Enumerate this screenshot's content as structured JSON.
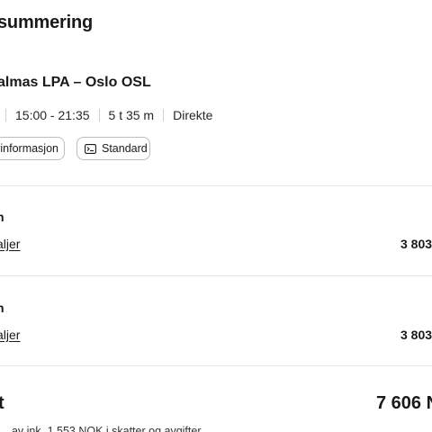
{
  "summary": {
    "title": "summering"
  },
  "flight": {
    "route": "almas LPA – Oslo OSL",
    "time": "15:00 - 21:35",
    "duration": "5 t 35 m",
    "stops": "Direkte",
    "info_chip_label": "yinformasjon",
    "fare_chip_label": "Standard"
  },
  "passengers": [
    {
      "label": "n",
      "details_label": "aljer",
      "price": "3 803"
    },
    {
      "label": "n",
      "details_label": "aljer",
      "price": "3 803"
    }
  ],
  "total": {
    "label": "t",
    "price": "7 606 N",
    "tax_note": "… av ink. 1 553 NOK i skatter og avgifter"
  },
  "icons": {
    "fare": "seat-icon"
  }
}
